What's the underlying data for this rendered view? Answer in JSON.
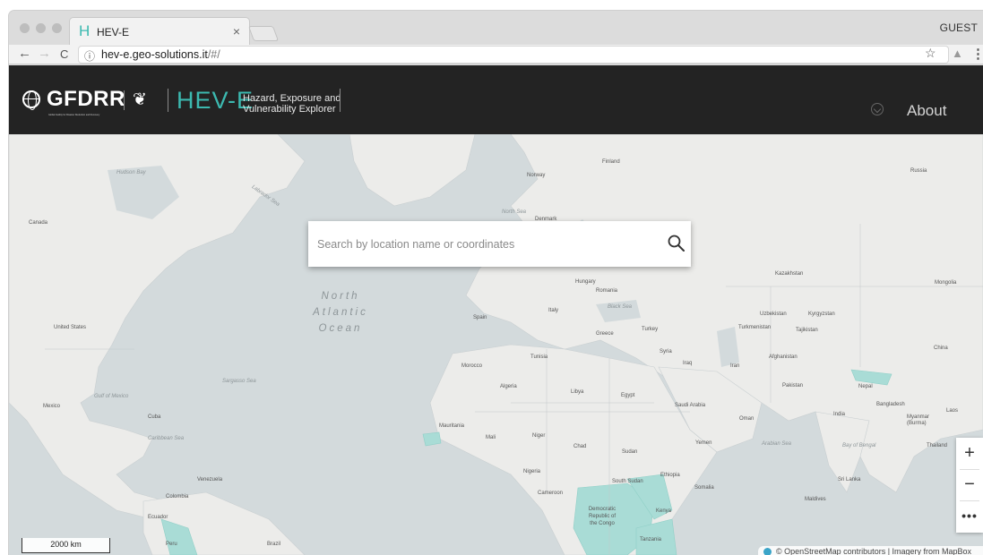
{
  "browser": {
    "tab_title": "HEV-E",
    "tab_close": "×",
    "favicon_glyph": "H",
    "profile": "GUEST",
    "url_host": "hev-e.geo-solutions.it",
    "url_path": "/#/",
    "info_icon": "ⓘ",
    "back_glyph": "←",
    "forward_glyph": "→",
    "reload_glyph": "C",
    "star_glyph": "☆",
    "menu_glyph": "⋮"
  },
  "header": {
    "org_name": "GFDRR",
    "org_subtitle": "Global Facility for Disaster Reduction and Recovery",
    "app_name": "HEV-E",
    "tagline_line1": "Hazard, Exposure and",
    "tagline_line2": "Vulnerability Explorer",
    "about_label": "About"
  },
  "search": {
    "placeholder": "Search by location name or coordinates"
  },
  "map": {
    "ocean_label": "North Atlantic Ocean",
    "scale_label": "2000 km",
    "attribution": "© OpenStreetMap contributors | Imagery from MapBox",
    "zoom_in": "+",
    "zoom_out": "−",
    "more": "•••",
    "labels": [
      {
        "text": "Canada"
      },
      {
        "text": "United States"
      },
      {
        "text": "Mexico"
      },
      {
        "text": "Cuba"
      },
      {
        "text": "Venezuela"
      },
      {
        "text": "Colombia"
      },
      {
        "text": "Ecuador"
      },
      {
        "text": "Peru"
      },
      {
        "text": "Brazil"
      },
      {
        "text": "Norway"
      },
      {
        "text": "Finland"
      },
      {
        "text": "Denmark"
      },
      {
        "text": "Hungary"
      },
      {
        "text": "Romania"
      },
      {
        "text": "Italy"
      },
      {
        "text": "Spain"
      },
      {
        "text": "Greece"
      },
      {
        "text": "Turkey"
      },
      {
        "text": "Syria"
      },
      {
        "text": "Iraq"
      },
      {
        "text": "Iran"
      },
      {
        "text": "Tunisia"
      },
      {
        "text": "Morocco"
      },
      {
        "text": "Algeria"
      },
      {
        "text": "Libya"
      },
      {
        "text": "Egypt"
      },
      {
        "text": "Saudi Arabia"
      },
      {
        "text": "Oman"
      },
      {
        "text": "Yemen"
      },
      {
        "text": "Mauritania"
      },
      {
        "text": "Mali"
      },
      {
        "text": "Niger"
      },
      {
        "text": "Chad"
      },
      {
        "text": "Sudan"
      },
      {
        "text": "Nigeria"
      },
      {
        "text": "South Sudan"
      },
      {
        "text": "Ethiopia"
      },
      {
        "text": "Somalia"
      },
      {
        "text": "Cameroon"
      },
      {
        "text": "Democratic Republic of the Congo"
      },
      {
        "text": "Kenya"
      },
      {
        "text": "Tanzania"
      },
      {
        "text": "Russia"
      },
      {
        "text": "Kazakhstan"
      },
      {
        "text": "Mongolia"
      },
      {
        "text": "Uzbekistan"
      },
      {
        "text": "Kyrgyzstan"
      },
      {
        "text": "Turkmenistan"
      },
      {
        "text": "Tajikistan"
      },
      {
        "text": "Afghanistan"
      },
      {
        "text": "Pakistan"
      },
      {
        "text": "Nepal"
      },
      {
        "text": "India"
      },
      {
        "text": "Bangladesh"
      },
      {
        "text": "Myanmar (Burma)"
      },
      {
        "text": "Laos"
      },
      {
        "text": "Thailand"
      },
      {
        "text": "China"
      },
      {
        "text": "Sri Lanka"
      },
      {
        "text": "Maldives"
      }
    ],
    "seas": [
      {
        "text": "Hudson Bay"
      },
      {
        "text": "Labrador Sea"
      },
      {
        "text": "North Sea"
      },
      {
        "text": "Black Sea"
      },
      {
        "text": "Sargasso Sea"
      },
      {
        "text": "Gulf of Mexico"
      },
      {
        "text": "Caribbean Sea"
      },
      {
        "text": "Arabian Sea"
      },
      {
        "text": "Bay of Bengal"
      }
    ]
  },
  "colors": {
    "accent": "#3cb9b0",
    "header_bg": "#232323",
    "land": "#ececea",
    "water": "#d3dadc",
    "highlight": "#a9dcd6"
  }
}
